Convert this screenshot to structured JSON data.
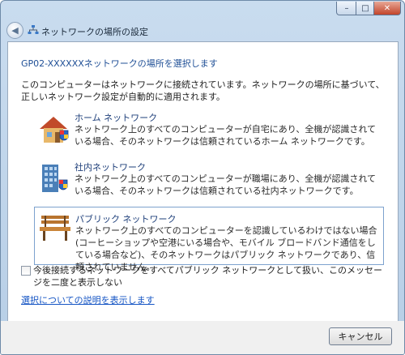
{
  "window": {
    "title": "ネットワークの場所の設定",
    "controls": {
      "minimize": "–",
      "maximize": "□",
      "close": "✕"
    }
  },
  "main": {
    "heading": "GP02-XXXXXXネットワークの場所を選択します",
    "description": "このコンピューターはネットワークに接続されています。ネットワークの場所に基づいて、正しいネットワーク設定が自動的に適用されます。",
    "options": [
      {
        "title": "ホーム ネットワーク",
        "text": "ネットワーク上のすべてのコンピューターが自宅にあり、全機が認識されている場合、そのネットワークは信頼されているホーム ネットワークです。",
        "icon": "house-icon"
      },
      {
        "title": "社内ネットワーク",
        "text": "ネットワーク上のすべてのコンピューターが職場にあり、全機が認識されている場合、そのネットワークは信頼されている社内ネットワークです。",
        "icon": "office-building-icon"
      },
      {
        "title": "パブリック ネットワーク",
        "text": "ネットワーク上のすべてのコンピューターを認識しているわけではない場合 (コーヒーショップや空港にいる場合や、モバイル ブロードバンド通信をしている場合など)、そのネットワークはパブリック ネットワークであり、信頼されていません。",
        "icon": "park-bench-icon",
        "selected": true
      }
    ],
    "checkbox_label": "今後接続するネットワークをすべてパブリック ネットワークとして扱い、このメッセージを二度と表示しない",
    "checkbox_checked": false,
    "help_link": "選択についての説明を表示します"
  },
  "footer": {
    "cancel_label": "キャンセル"
  },
  "colors": {
    "accent": "#1f4f96",
    "link": "#1555c4",
    "selection_border": "#7da2ce"
  }
}
